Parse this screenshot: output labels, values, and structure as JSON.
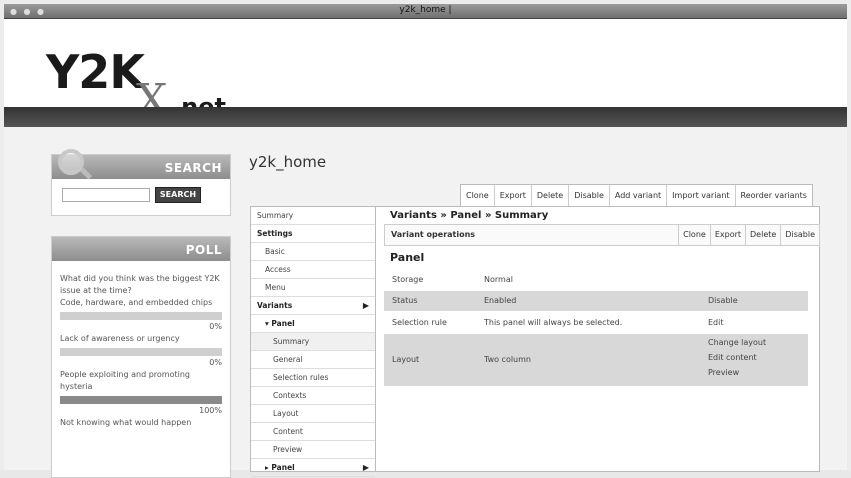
{
  "window": {
    "title": "y2k_home |"
  },
  "logo": {
    "y2k": "Y2K",
    "x": "X",
    "net": ".net"
  },
  "search": {
    "title": "SEARCH",
    "button": "SEARCH",
    "value": ""
  },
  "poll": {
    "title": "POLL",
    "question": "What did you think was the biggest Y2K issue at the time?",
    "options": [
      {
        "label": "Code, hardware, and embedded chips",
        "pct": "0%",
        "fill": 0
      },
      {
        "label": "Lack of awareness or urgency",
        "pct": "0%",
        "fill": 0
      },
      {
        "label": "People exploiting and promoting hysteria",
        "pct": "100%",
        "fill": 100
      },
      {
        "label": "Not knowing what would happen",
        "pct": "",
        "fill": 0
      }
    ]
  },
  "page": {
    "title": "y2k_home"
  },
  "top_tabs": [
    "Clone",
    "Export",
    "Delete",
    "Disable",
    "Add variant",
    "Import variant",
    "Reorder variants"
  ],
  "nav": [
    {
      "label": "Summary",
      "style": ""
    },
    {
      "label": "Settings",
      "style": "bold"
    },
    {
      "label": "Basic",
      "style": "ind1"
    },
    {
      "label": "Access",
      "style": "ind1"
    },
    {
      "label": "Menu",
      "style": "ind1"
    },
    {
      "label": "Variants",
      "style": "bold",
      "arrow": "▶"
    },
    {
      "label": "▾ Panel",
      "style": "bold ind1"
    },
    {
      "label": "Summary",
      "style": "ind2 sel"
    },
    {
      "label": "General",
      "style": "ind2"
    },
    {
      "label": "Selection rules",
      "style": "ind2"
    },
    {
      "label": "Contexts",
      "style": "ind2"
    },
    {
      "label": "Layout",
      "style": "ind2"
    },
    {
      "label": "Content",
      "style": "ind2"
    },
    {
      "label": "Preview",
      "style": "ind2"
    },
    {
      "label": "▸ Panel",
      "style": "bold ind1",
      "arrow": "▶"
    }
  ],
  "breadcrumb": "Variants » Panel » Summary",
  "ops": {
    "label": "Variant operations",
    "buttons": [
      "Clone",
      "Export",
      "Delete",
      "Disable"
    ]
  },
  "section": "Panel",
  "rows": [
    {
      "key": "Storage",
      "value": "Normal",
      "actions": []
    },
    {
      "key": "Status",
      "value": "Enabled",
      "actions": [
        "Disable"
      ]
    },
    {
      "key": "Selection rule",
      "value": "This panel will always be selected.",
      "actions": [
        "Edit"
      ]
    },
    {
      "key": "Layout",
      "value": "Two column",
      "actions": [
        "Change layout",
        "Edit content",
        "Preview"
      ]
    }
  ]
}
